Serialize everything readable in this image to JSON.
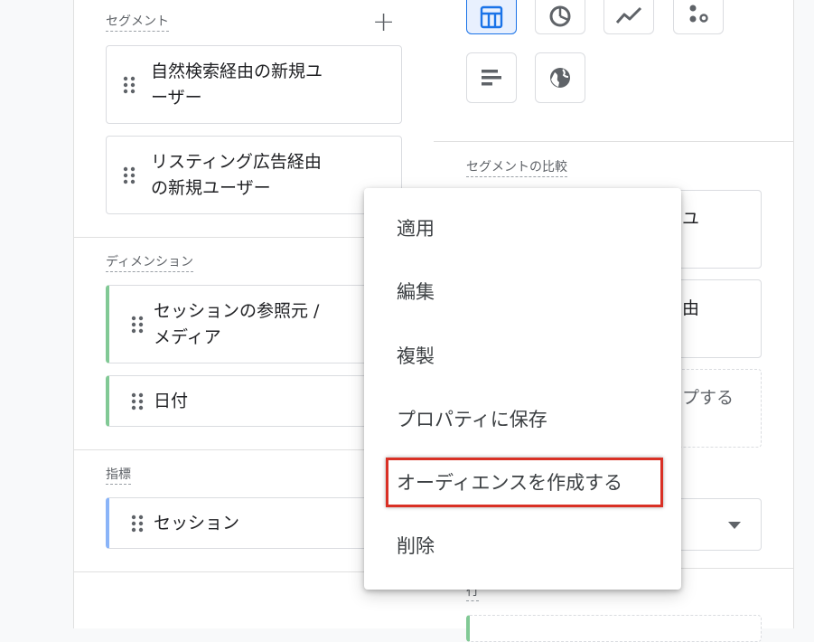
{
  "segments": {
    "title": "セグメント",
    "add_icon": "plus-icon",
    "items": [
      {
        "label": "自然検索経由の新規ユ\nーザー"
      },
      {
        "label": "リスティング広告経由\nの新規ユーザー"
      }
    ]
  },
  "dimensions": {
    "title": "ディメンション",
    "items": [
      {
        "label": "セッションの参照元 /\nメディア",
        "color": "#81c995"
      },
      {
        "label": "日付",
        "color": "#81c995"
      }
    ]
  },
  "metrics": {
    "title": "指標",
    "items": [
      {
        "label": "セッション",
        "color": "#8ab4f8"
      }
    ]
  },
  "visualization": {
    "buttons": [
      {
        "icon": "table-icon",
        "selected": true
      },
      {
        "icon": "donut-chart-icon",
        "selected": false
      },
      {
        "icon": "line-chart-icon",
        "selected": false
      },
      {
        "icon": "scatter-chart-icon",
        "selected": false
      },
      {
        "icon": "bar-chart-icon",
        "selected": false
      },
      {
        "icon": "geo-map-icon",
        "selected": false
      }
    ]
  },
  "segment_comparison": {
    "title": "セグメントの比較",
    "items": [
      {
        "visible_fragment": "ユ"
      },
      {
        "visible_fragment": "由"
      }
    ],
    "drop_zone_fragment": "プする"
  },
  "rows": {
    "title": "行"
  },
  "context_menu": {
    "items": [
      {
        "label": "適用"
      },
      {
        "label": "編集"
      },
      {
        "label": "複製"
      },
      {
        "label": "プロパティに保存"
      },
      {
        "label": "オーディエンスを作成する",
        "highlighted": true
      },
      {
        "label": "削除"
      }
    ]
  },
  "colors": {
    "accent": "#1a73e8",
    "highlight_border": "#d93025",
    "dimension_bar": "#81c995",
    "metric_bar": "#8ab4f8"
  }
}
